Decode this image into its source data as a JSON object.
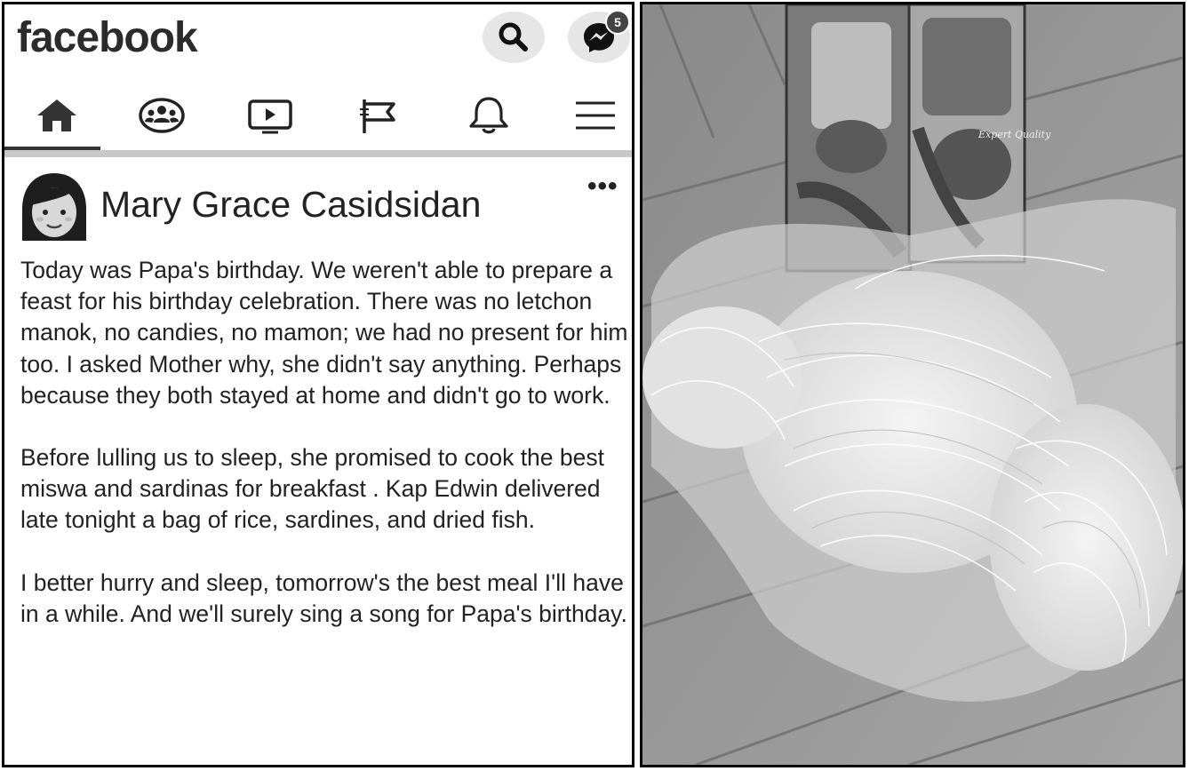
{
  "app": {
    "logo_text": "facebook"
  },
  "header": {
    "search_icon": "search-icon",
    "messenger_icon": "messenger-icon",
    "messenger_badge": "5"
  },
  "nav": {
    "tabs": [
      {
        "icon": "home-icon",
        "active": true
      },
      {
        "icon": "groups-icon",
        "active": false
      },
      {
        "icon": "watch-icon",
        "active": false
      },
      {
        "icon": "pages-flag-icon",
        "active": false
      },
      {
        "icon": "bell-icon",
        "active": false
      },
      {
        "icon": "menu-icon",
        "active": false
      }
    ]
  },
  "post": {
    "author": "Mary Grace Casidsidan",
    "more_label": "•••",
    "paragraphs": [
      "Today was Papa's birthday. We weren't able to prepare a feast for his birthday celebration. There was no letchon manok, no candies, no mamon; we had no present for him too. I asked Mother why, she didn't say anything. Perhaps because they both stayed at home and didn't go to work.",
      "Before lulling us to sleep, she promised to cook the best miswa and sardinas for breakfast . Kap Edwin delivered late tonight a bag of rice, sardines, and dried fish.",
      "I better hurry and sleep, tomorrow's the best meal I'll have in a while. And we'll surely sing a song for Papa's birthday."
    ]
  },
  "photo": {
    "can_label": "Expert Quality"
  },
  "colors": {
    "text": "#222222",
    "panel_border": "#000000",
    "button_bg": "#e6e6e6"
  }
}
